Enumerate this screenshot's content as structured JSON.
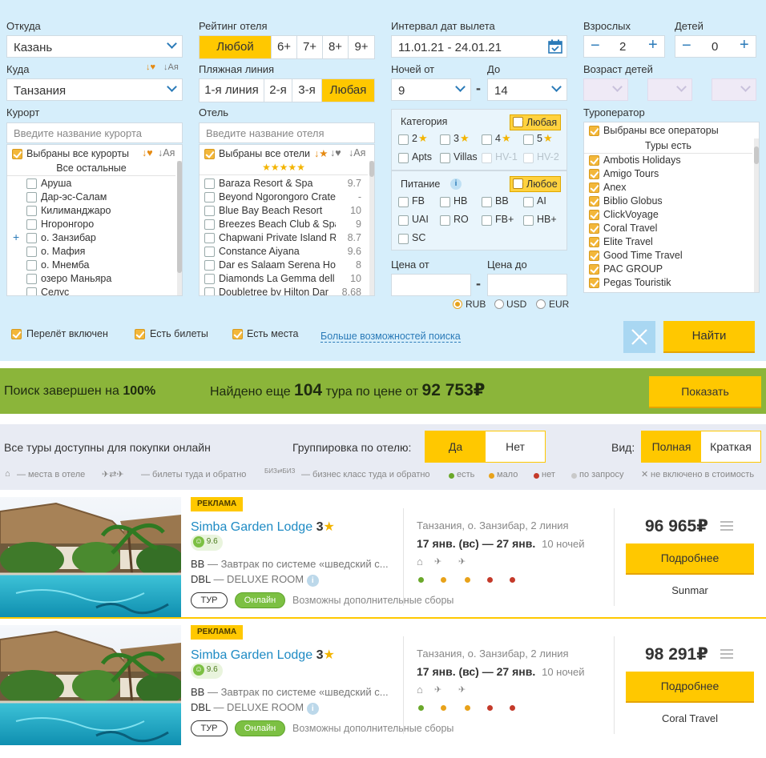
{
  "search": {
    "from": {
      "label": "Откуда",
      "value": "Казань"
    },
    "to": {
      "label": "Куда",
      "value": "Танзания"
    },
    "resort": {
      "label": "Курорт",
      "placeholder": "Введите название курорта",
      "all_selected": "Выбраны все курорты",
      "sort_label": "Ая",
      "section": "Все остальные",
      "items": [
        "Аруша",
        "Дар-эс-Салам",
        "Килиманджаро",
        "Нгоронгоро",
        "о. Занзибар",
        "о. Мафия",
        "о. Мнемба",
        "озеро Маньяра",
        "Селус"
      ]
    },
    "rating": {
      "label": "Рейтинг отеля",
      "options": [
        "Любой",
        "6+",
        "7+",
        "8+",
        "9+"
      ],
      "selected": "Любой"
    },
    "beach": {
      "label": "Пляжная линия",
      "options": [
        "1-я линия",
        "2-я",
        "3-я",
        "Любая"
      ],
      "selected": "Любая"
    },
    "hotel": {
      "label": "Отель",
      "placeholder": "Введите название отеля",
      "all_selected": "Выбраны все отели",
      "sort_label": "Ая",
      "stars": "★★★★★",
      "items": [
        {
          "name": "Baraza Resort & Spa",
          "rating": "9.7"
        },
        {
          "name": "Beyond Ngorongoro Crate",
          "rating": "-"
        },
        {
          "name": "Blue Bay Beach Resort",
          "rating": "10"
        },
        {
          "name": "Breezes Beach Club & Spa",
          "rating": "9"
        },
        {
          "name": "Chapwani Private Island R",
          "rating": "8.7"
        },
        {
          "name": "Constance Aiyana",
          "rating": "9.6"
        },
        {
          "name": "Dar es Salaam Serena Hot",
          "rating": "8"
        },
        {
          "name": "Diamonds La Gemma dell",
          "rating": "10"
        },
        {
          "name": "Doubletree by Hilton Dar",
          "rating": "8.68"
        }
      ]
    },
    "dates": {
      "label": "Интервал дат вылета",
      "value": "11.01.21 - 24.01.21"
    },
    "nights": {
      "from_label": "Ночей от",
      "from": "9",
      "to_label": "До",
      "to": "14",
      "dash": "-"
    },
    "category": {
      "label": "Категория",
      "any": "Любая",
      "options": [
        "2",
        "3",
        "4",
        "5",
        "Apts",
        "Villas",
        "HV-1",
        "HV-2"
      ]
    },
    "meal": {
      "label": "Питание",
      "info": "i",
      "any": "Любое",
      "options": [
        "FB",
        "HB",
        "BB",
        "AI",
        "UAI",
        "RO",
        "FB+",
        "HB+",
        "SC"
      ]
    },
    "price": {
      "from_label": "Цена от",
      "to_label": "Цена до",
      "dash": "-",
      "currencies": [
        "RUB",
        "USD",
        "EUR"
      ],
      "selected_currency": "RUB"
    },
    "adults": {
      "label": "Взрослых",
      "value": "2"
    },
    "children": {
      "label": "Детей",
      "value": "0"
    },
    "child_age": {
      "label": "Возраст детей"
    },
    "operators": {
      "label": "Туроператор",
      "all_selected": "Выбраны все операторы",
      "section": "Туры есть",
      "items": [
        "Ambotis Holidays",
        "Amigo Tours",
        "Anex",
        "Biblio Globus",
        "ClickVoyage",
        "Coral Travel",
        "Elite Travel",
        "Good Time Travel",
        "PAC GROUP",
        "Pegas Touristik"
      ]
    },
    "flags": [
      "Перелёт включен",
      "Есть билеты",
      "Есть места"
    ],
    "more_link": "Больше возможностей поиска",
    "find_button": "Найти"
  },
  "status": {
    "done_text": "Поиск завершен на",
    "done_pct": "100%",
    "found_prefix": "Найдено еще",
    "found_count": "104",
    "found_mid": "тура по цене от",
    "found_price": "92 753",
    "currency": "₽",
    "show_button": "Показать"
  },
  "toolbar": {
    "online_note": "Все туры доступны для покупки онлайн",
    "group_label": "Группировка по отелю:",
    "group_options": [
      "Да",
      "Нет"
    ],
    "view_label": "Вид:",
    "view_options": [
      "Полная",
      "Краткая"
    ],
    "legend": [
      "— места в отеле",
      "— билеты туда и обратно",
      "— бизнес класс туда и обратно",
      "есть",
      "мало",
      "нет",
      "по запросу",
      "не включено в стоимость"
    ],
    "biz": "БИЗ"
  },
  "tours": [
    {
      "ad": "РЕКЛАМА",
      "name": "Simba Garden Lodge",
      "stars": "3",
      "score": "9.6",
      "meal_code": "BB",
      "meal_desc": "— Завтрак по системе «шведский с...",
      "room_code": "DBL",
      "room_desc": "— DELUXE ROOM",
      "tag_tour": "ТУР",
      "tag_online": "Онлайн",
      "extra": "Возможны дополнительные сборы",
      "location": "Танзания, о. Занзибар, 2 линия",
      "dates": "17 янв. (вс) — 27 янв.",
      "nights": "10 ночей",
      "price": "96 965",
      "currency": "₽",
      "button": "Подробнее",
      "operator": "Sunmar",
      "dots": [
        "#6aa82a",
        "#e8a21a",
        "#e8a21a",
        "#c43a2a",
        "#c43a2a"
      ]
    },
    {
      "ad": "РЕКЛАМА",
      "name": "Simba Garden Lodge",
      "stars": "3",
      "score": "9.6",
      "meal_code": "BB",
      "meal_desc": "— Завтрак по системе «шведский с...",
      "room_code": "DBL",
      "room_desc": "— DELUXE ROOM",
      "tag_tour": "ТУР",
      "tag_online": "Онлайн",
      "extra": "Возможны дополнительные сборы",
      "location": "Танзания, о. Занзибар, 2 линия",
      "dates": "17 янв. (вс) — 27 янв.",
      "nights": "10 ночей",
      "price": "98 291",
      "currency": "₽",
      "button": "Подробнее",
      "operator": "Coral Travel",
      "dots": [
        "#6aa82a",
        "#e8a21a",
        "#e8a21a",
        "#c43a2a",
        "#c43a2a"
      ]
    }
  ],
  "colors": {
    "accent": "#ffc800",
    "link": "#1f8bc4",
    "panel": "#d6eefb",
    "status_bar": "#8bb53a"
  }
}
